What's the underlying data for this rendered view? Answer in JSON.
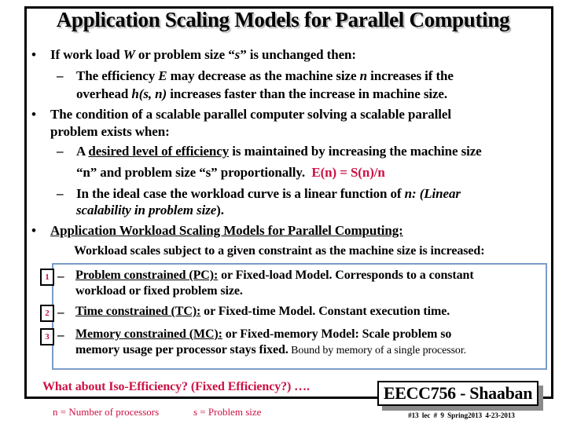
{
  "slide": {
    "title": "Application Scaling Models for Parallel Computing",
    "bullet1": {
      "prefix": "If work load ",
      "var_w": "W",
      "middle": " or problem size “",
      "var_s": "s",
      "suffix": "” is unchanged then:",
      "sub1": {
        "line1_prefix": "The efficiency ",
        "var_e": "E",
        "line1_middle": " may decrease as the machine size ",
        "var_n": "n",
        "line1_suffix": " increases if the",
        "line2_prefix": "overhead ",
        "var_h": "h(s, n)",
        "line2_suffix": " increases faster than the increase in machine size."
      }
    },
    "bullet2": {
      "line1": "The condition of a scalable parallel computer solving a scalable parallel",
      "line2": "problem exists when:",
      "sub1": {
        "prefix": "A ",
        "underlined": "desired level of efficiency",
        "suffix": " is maintained by increasing the machine size",
        "line2": "“n” and problem size “s” proportionally.",
        "formula": "E(n) = S(n)/n"
      },
      "sub2": {
        "line1_prefix": "In the ideal case the workload curve is a linear function of ",
        "line1_italic": "n: (Linear",
        "line2_italic": "scalability in problem size",
        "line2_suffix": ")."
      }
    },
    "bullet3": {
      "heading": "Application Workload Scaling Models for Parallel Computing:",
      "subheading": "Workload scales subject to a given constraint as the machine size is increased:"
    },
    "models": [
      {
        "number": "1",
        "name": "Problem constrained (PC):",
        "line1": " or Fixed-load Model.  Corresponds to a constant",
        "line2": "workload or fixed problem size."
      },
      {
        "number": "2",
        "name": "Time constrained (TC):",
        "line1": " or Fixed-time Model.  Constant execution time.",
        "line2": ""
      },
      {
        "number": "3",
        "name": "Memory constrained (MC):",
        "line1": " or Fixed-memory Model:  Scale problem so",
        "line2": "memory usage per processor stays fixed.",
        "line2_note": " Bound  by memory of a single processor."
      }
    ],
    "question": "What about Iso-Efficiency? (Fixed Efficiency?) ….",
    "legend": {
      "n": "n = Number of processors",
      "s": "s = Problem size"
    },
    "footer": {
      "course": "EECC756 - Shaaban",
      "meta": "#13  lec # 9   Spring2013  4-23-2013"
    },
    "bullet_glyph": "•",
    "dash_glyph": "–",
    "colors": {
      "accent_red": "#cc1144",
      "inner_box_border": "#7a9cc8"
    }
  }
}
